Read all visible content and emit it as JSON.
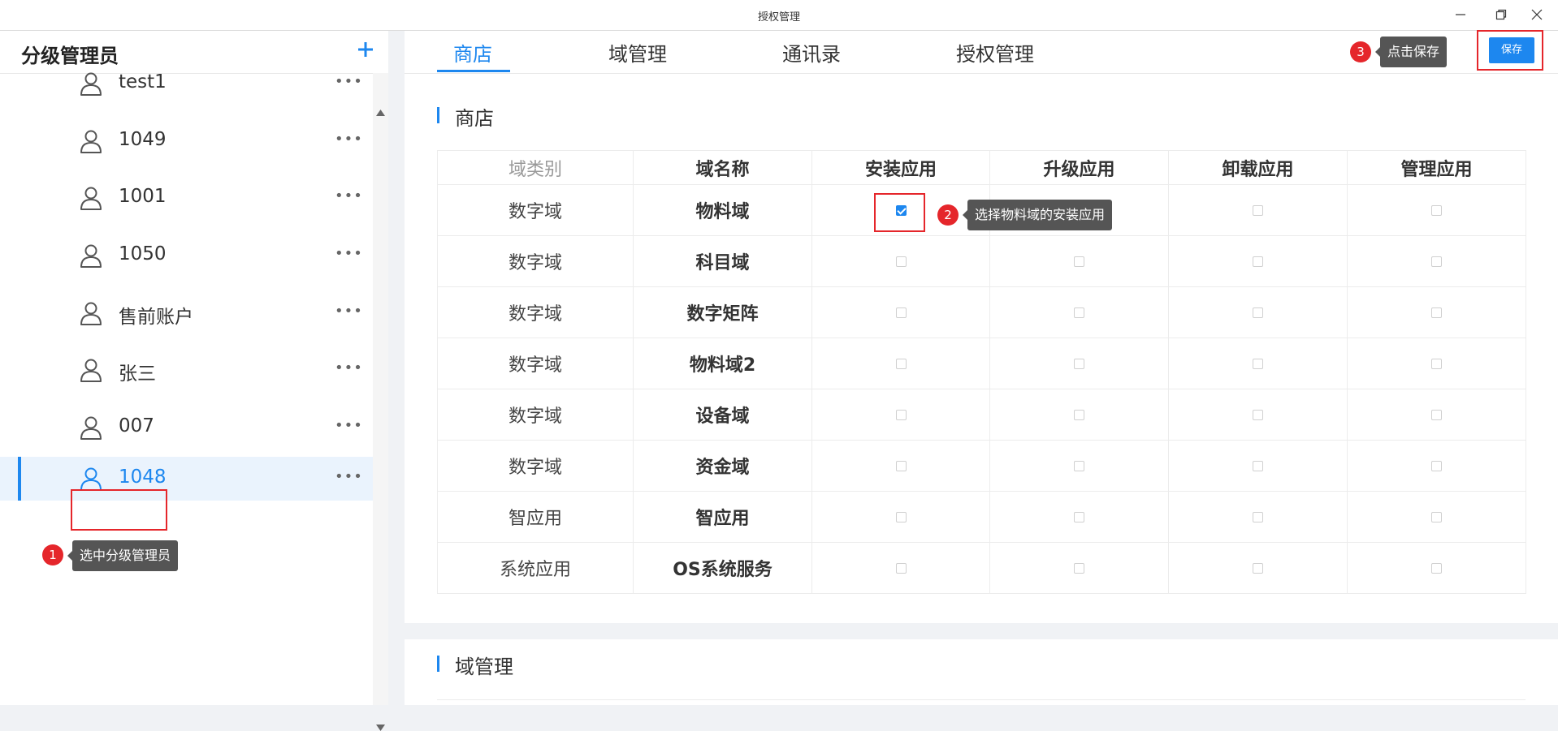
{
  "window": {
    "title": "授权管理"
  },
  "sidebar": {
    "title": "分级管理员",
    "users": [
      {
        "name": "test1"
      },
      {
        "name": "1049"
      },
      {
        "name": "1001"
      },
      {
        "name": "1050"
      },
      {
        "name": "售前账户"
      },
      {
        "name": "张三"
      },
      {
        "name": "007"
      },
      {
        "name": "1048",
        "selected": true
      }
    ],
    "more_label": "•••"
  },
  "tabs": [
    {
      "label": "商店",
      "active": true
    },
    {
      "label": "域管理"
    },
    {
      "label": "通讯录"
    },
    {
      "label": "授权管理"
    }
  ],
  "save_label": "保存",
  "annotations": [
    {
      "number": "1",
      "text": "选中分级管理员"
    },
    {
      "number": "2",
      "text": "选择物料域的安装应用"
    },
    {
      "number": "3",
      "text": "点击保存"
    }
  ],
  "store_section": {
    "title": "商店",
    "columns": [
      "域类别",
      "域名称",
      "安装应用",
      "升级应用",
      "卸载应用",
      "管理应用"
    ],
    "rows": [
      {
        "category": "数字域",
        "name": "物料域",
        "install": true,
        "upgrade": false,
        "uninstall": false,
        "manage": false
      },
      {
        "category": "数字域",
        "name": "科目域",
        "install": false,
        "upgrade": false,
        "uninstall": false,
        "manage": false
      },
      {
        "category": "数字域",
        "name": "数字矩阵",
        "install": false,
        "upgrade": false,
        "uninstall": false,
        "manage": false
      },
      {
        "category": "数字域",
        "name": "物料域2",
        "install": false,
        "upgrade": false,
        "uninstall": false,
        "manage": false
      },
      {
        "category": "数字域",
        "name": "设备域",
        "install": false,
        "upgrade": false,
        "uninstall": false,
        "manage": false
      },
      {
        "category": "数字域",
        "name": "资金域",
        "install": false,
        "upgrade": false,
        "uninstall": false,
        "manage": false
      },
      {
        "category": "智应用",
        "name": "智应用",
        "install": false,
        "upgrade": false,
        "uninstall": false,
        "manage": false
      },
      {
        "category": "系统应用",
        "name": "OS系统服务",
        "install": false,
        "upgrade": false,
        "uninstall": false,
        "manage": false
      }
    ]
  },
  "domain_section": {
    "title": "域管理"
  },
  "colors": {
    "accent": "#1d87ef",
    "annotation_red": "#e5262b",
    "tooltip_bg": "#555555"
  }
}
